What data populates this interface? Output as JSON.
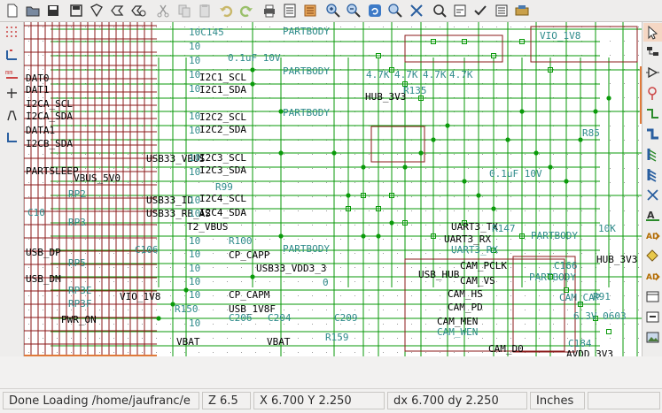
{
  "toolbar": {
    "icons": [
      "new-icon",
      "open-icon",
      "save-icon",
      "save-as-icon",
      "page-setup-icon",
      "print-icon",
      "library-icon",
      "cut-icon",
      "copy-icon",
      "paste-icon",
      "undo-icon",
      "redo-icon",
      "plot-icon",
      "netlist-icon",
      "zoom-in-icon",
      "zoom-out-icon",
      "redraw-icon",
      "zoom-fit-icon",
      "find-icon",
      "annotate-icon",
      "erc-icon",
      "bom-icon",
      "cvpcb-icon"
    ]
  },
  "canvas": {
    "labels": {
      "vio_1v8": "VIO_1V8",
      "partbody1": "PARTBODY",
      "partbody2": "PARTBODY",
      "partbody3": "PARTBODY",
      "partbody4": "PARTBODY",
      "partbody5": "PARTBODY",
      "partbody6": "PARTBODY",
      "cap01u": "0.1uF 10V",
      "res47a": "4.7K",
      "res47b": "4.7K",
      "res47c": "4.7K",
      "res47d": "4.7K",
      "hub_3v3": "HUB_3V3",
      "r135": "R135",
      "r85": "R85",
      "cap01u_2": "0.1uF 10V",
      "i2c1_scl": "I2C1_SCL",
      "i2c1_sda": "I2C1_SDA",
      "i2c2_scl": "I2C2_SCL",
      "i2c2_sda": "I2C2_SDA",
      "i2c3_scl": "I2C3_SCL",
      "i2c3_sda": "I2C3_SDA",
      "i2c4_scl": "I2C4_SCL",
      "i2c4_sda": "I2C4_SDA",
      "usb33_vbus": "USB33_VBUS",
      "usb33_id": "USB33_ID",
      "usb33_rb_as": "USB33_RB_AS",
      "r99": "R99",
      "t2_vbus": "T2_VBUS",
      "r100": "R100",
      "cp_capp": "CP_CAPP",
      "usb33_vdd3_3": "USB33_VDD3_3",
      "cp_capm": "CP_CAPM",
      "usb_1v8f": "USB_1V8F",
      "c206": "C206",
      "c204": "C204",
      "c209": "C209",
      "r159": "R159",
      "vbat1": "VBAT",
      "vbat2": "VBAT",
      "vio_1v8b": "VIO_1V8",
      "r150": "R150",
      "pwr_on": "PWR_ON",
      "c106": "C106",
      "uart3_tx": "UART3_TX",
      "uart3_rx": "UART3_RX",
      "uart3_rx2": "UART3_RX",
      "r147": "R147",
      "k10": "10K",
      "cam_pclk": "CAM_PCLK",
      "cam_vs": "CAM_VS",
      "cam_hs": "CAM_HS",
      "cam_pd": "CAM_PD",
      "cam_men": "CAM_MEN",
      "cam_wen": "CAM_WEN",
      "cam_d0": "CAM_D0",
      "usb_hub": "USB_HUB",
      "c166": "C166",
      "r91": "R91",
      "hub_3v3b": "HUB_3V3",
      "c184": "C184",
      "avdd_3v3": "AVDD_3V3",
      "cam_cap": "CAM_CAP",
      "cap_0402": "6.3V 0603",
      "ten_a": "10",
      "ten_b": "10",
      "ten_c": "10",
      "ten_d": "10",
      "ten_e": "10",
      "ten_f": "10",
      "ten_g": "10",
      "ten_h": "10",
      "ten_i": "10",
      "ten_j": "10",
      "ten_k": "10",
      "ten_l": "10",
      "ten_m": "10",
      "ten_n": "10",
      "ten_o": "10",
      "ten_p": "10",
      "c145": "10C145",
      "zero": "0",
      "dat0": "DAT0",
      "dat1": "DAT1",
      "i2cs_scl": "I2CA_SCL",
      "i2cs_sda": "I2CA_SDA",
      "data1": "DATA1",
      "sda0": "I2CB_SDA",
      "partsleep": "PARTSLEEP",
      "vbus5": "VBUS_5V0",
      "rp2": "RP2",
      "rp3": "RP3",
      "rp5": "RP5",
      "c10": "C10",
      "usbdp": "USB_DP",
      "usbdm": "USB_DM",
      "rp3e": "RP3E",
      "rp3f": "RP3F"
    }
  },
  "status": {
    "message": "Done Loading /home/jaufranc/e",
    "zoom": "Z 6.5",
    "xy": "X 6.700  Y 2.250",
    "dxdy": "dx 6.700  dy 2.250",
    "units": "Inches"
  }
}
